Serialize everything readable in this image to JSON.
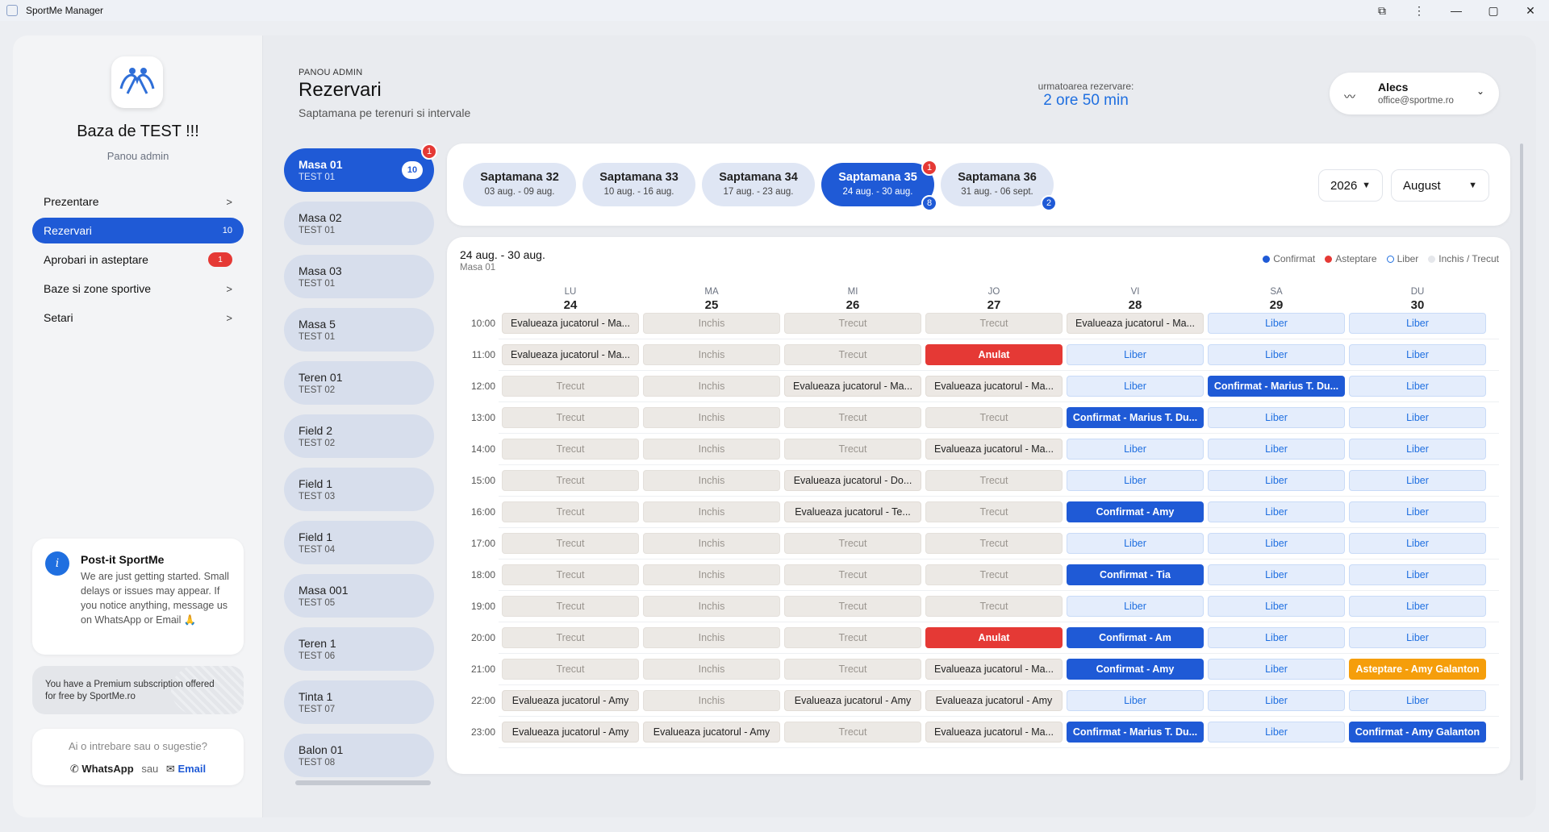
{
  "window": {
    "title": "SportMe Manager"
  },
  "sidebar": {
    "base_name": "Baza de TEST !!!",
    "base_sub": "Panou admin",
    "nav": [
      {
        "label": "Prezentare",
        "chevron": ">"
      },
      {
        "label": "Rezervari",
        "count": "10",
        "active": true
      },
      {
        "label": "Aprobari in asteptare",
        "badge": "1"
      },
      {
        "label": "Baze si zone sportive",
        "chevron": ">"
      },
      {
        "label": "Setari",
        "chevron": ">"
      }
    ],
    "postit": {
      "title": "Post-it SportMe",
      "text": "We are just getting started. Small delays or issues may appear. If you notice anything, message us on WhatsApp or Email 🙏"
    },
    "premium_text": "You have a Premium subscription offered for free by SportMe.ro",
    "question": {
      "text": "Ai o intrebare sau o sugestie?",
      "whatsapp": "WhatsApp",
      "sau": "sau",
      "email": "Email"
    }
  },
  "header": {
    "overline": "PANOU ADMIN",
    "title": "Rezervari",
    "subtitle": "Saptamana pe terenuri si intervale",
    "next_label": "urmatoarea rezervare:",
    "next_value": "2 ore 50 min"
  },
  "user": {
    "name": "Alecs",
    "email": "office@sportme.ro"
  },
  "resources": [
    {
      "name": "Masa 01",
      "sub": "TEST 01",
      "count": "10",
      "alert": "1",
      "active": true
    },
    {
      "name": "Masa 02",
      "sub": "TEST 01"
    },
    {
      "name": "Masa 03",
      "sub": "TEST 01"
    },
    {
      "name": "Masa 5",
      "sub": "TEST 01"
    },
    {
      "name": "Teren 01",
      "sub": "TEST 02"
    },
    {
      "name": "Field 2",
      "sub": "TEST 02"
    },
    {
      "name": "Field 1",
      "sub": "TEST 03"
    },
    {
      "name": "Field 1",
      "sub": "TEST 04"
    },
    {
      "name": "Masa 001",
      "sub": "TEST 05"
    },
    {
      "name": "Teren 1",
      "sub": "TEST 06"
    },
    {
      "name": "Tinta 1",
      "sub": "TEST 07"
    },
    {
      "name": "Balon 01",
      "sub": "TEST 08"
    }
  ],
  "weeks": [
    {
      "name": "Saptamana 32",
      "range": "03 aug. - 09 aug."
    },
    {
      "name": "Saptamana 33",
      "range": "10 aug. - 16 aug."
    },
    {
      "name": "Saptamana 34",
      "range": "17 aug. - 23 aug."
    },
    {
      "name": "Saptamana 35",
      "range": "24 aug. - 30 aug.",
      "active": true,
      "alert": "1",
      "count": "8"
    },
    {
      "name": "Saptamana 36",
      "range": "31 aug. - 06 sept.",
      "count": "2"
    }
  ],
  "year_select": "2026",
  "month_select": "August",
  "calendar": {
    "range": "24 aug. - 30 aug.",
    "resource": "Masa 01",
    "legend": [
      {
        "label": "Confirmat",
        "color": "#1f5ad6"
      },
      {
        "label": "Asteptare",
        "color": "#e53935"
      },
      {
        "label": "Liber",
        "color": "ring"
      },
      {
        "label": "Inchis / Trecut",
        "color": "#e5e7eb"
      }
    ],
    "days": [
      {
        "name": "LU",
        "num": "24"
      },
      {
        "name": "MA",
        "num": "25"
      },
      {
        "name": "MI",
        "num": "26"
      },
      {
        "name": "JO",
        "num": "27"
      },
      {
        "name": "VI",
        "num": "28"
      },
      {
        "name": "SA",
        "num": "29"
      },
      {
        "name": "DU",
        "num": "30"
      }
    ],
    "times": [
      "10:00",
      "11:00",
      "12:00",
      "13:00",
      "14:00",
      "15:00",
      "16:00",
      "17:00",
      "18:00",
      "19:00",
      "20:00",
      "21:00",
      "22:00",
      "23:00"
    ],
    "rows": [
      [
        [
          "booked",
          "Evalueaza jucatorul - Ma..."
        ],
        [
          "closed",
          "Inchis"
        ],
        [
          "past",
          "Trecut"
        ],
        [
          "past",
          "Trecut"
        ],
        [
          "booked",
          "Evalueaza jucatorul - Ma..."
        ],
        [
          "free",
          "Liber"
        ],
        [
          "free",
          "Liber"
        ]
      ],
      [
        [
          "booked",
          "Evalueaza jucatorul - Ma..."
        ],
        [
          "closed",
          "Inchis"
        ],
        [
          "past",
          "Trecut"
        ],
        [
          "cancelled",
          "Anulat"
        ],
        [
          "free",
          "Liber"
        ],
        [
          "free",
          "Liber"
        ],
        [
          "free",
          "Liber"
        ]
      ],
      [
        [
          "past",
          "Trecut"
        ],
        [
          "closed",
          "Inchis"
        ],
        [
          "booked",
          "Evalueaza jucatorul - Ma..."
        ],
        [
          "booked",
          "Evalueaza jucatorul - Ma..."
        ],
        [
          "free",
          "Liber"
        ],
        [
          "confirmed",
          "Confirmat - Marius T. Du..."
        ],
        [
          "free",
          "Liber"
        ]
      ],
      [
        [
          "past",
          "Trecut"
        ],
        [
          "closed",
          "Inchis"
        ],
        [
          "past",
          "Trecut"
        ],
        [
          "past",
          "Trecut"
        ],
        [
          "confirmed",
          "Confirmat - Marius T. Du..."
        ],
        [
          "free",
          "Liber"
        ],
        [
          "free",
          "Liber"
        ]
      ],
      [
        [
          "past",
          "Trecut"
        ],
        [
          "closed",
          "Inchis"
        ],
        [
          "past",
          "Trecut"
        ],
        [
          "booked",
          "Evalueaza jucatorul - Ma..."
        ],
        [
          "free",
          "Liber"
        ],
        [
          "free",
          "Liber"
        ],
        [
          "free",
          "Liber"
        ]
      ],
      [
        [
          "past",
          "Trecut"
        ],
        [
          "closed",
          "Inchis"
        ],
        [
          "booked",
          "Evalueaza jucatorul - Do..."
        ],
        [
          "past",
          "Trecut"
        ],
        [
          "free",
          "Liber"
        ],
        [
          "free",
          "Liber"
        ],
        [
          "free",
          "Liber"
        ]
      ],
      [
        [
          "past",
          "Trecut"
        ],
        [
          "closed",
          "Inchis"
        ],
        [
          "booked",
          "Evalueaza jucatorul - Te..."
        ],
        [
          "past",
          "Trecut"
        ],
        [
          "confirmed",
          "Confirmat - Amy"
        ],
        [
          "free",
          "Liber"
        ],
        [
          "free",
          "Liber"
        ]
      ],
      [
        [
          "past",
          "Trecut"
        ],
        [
          "closed",
          "Inchis"
        ],
        [
          "past",
          "Trecut"
        ],
        [
          "past",
          "Trecut"
        ],
        [
          "free",
          "Liber"
        ],
        [
          "free",
          "Liber"
        ],
        [
          "free",
          "Liber"
        ]
      ],
      [
        [
          "past",
          "Trecut"
        ],
        [
          "closed",
          "Inchis"
        ],
        [
          "past",
          "Trecut"
        ],
        [
          "past",
          "Trecut"
        ],
        [
          "confirmed",
          "Confirmat - Tia"
        ],
        [
          "free",
          "Liber"
        ],
        [
          "free",
          "Liber"
        ]
      ],
      [
        [
          "past",
          "Trecut"
        ],
        [
          "closed",
          "Inchis"
        ],
        [
          "past",
          "Trecut"
        ],
        [
          "past",
          "Trecut"
        ],
        [
          "free",
          "Liber"
        ],
        [
          "free",
          "Liber"
        ],
        [
          "free",
          "Liber"
        ]
      ],
      [
        [
          "past",
          "Trecut"
        ],
        [
          "closed",
          "Inchis"
        ],
        [
          "past",
          "Trecut"
        ],
        [
          "cancelled",
          "Anulat"
        ],
        [
          "confirmed",
          "Confirmat - Am"
        ],
        [
          "free",
          "Liber"
        ],
        [
          "free",
          "Liber"
        ]
      ],
      [
        [
          "past",
          "Trecut"
        ],
        [
          "closed",
          "Inchis"
        ],
        [
          "past",
          "Trecut"
        ],
        [
          "booked",
          "Evalueaza jucatorul - Ma..."
        ],
        [
          "confirmed",
          "Confirmat - Amy"
        ],
        [
          "free",
          "Liber"
        ],
        [
          "pending",
          "Asteptare - Amy Galanton"
        ]
      ],
      [
        [
          "booked",
          "Evalueaza jucatorul - Amy"
        ],
        [
          "closed",
          "Inchis"
        ],
        [
          "booked",
          "Evalueaza jucatorul - Amy"
        ],
        [
          "booked",
          "Evalueaza jucatorul - Amy"
        ],
        [
          "free",
          "Liber"
        ],
        [
          "free",
          "Liber"
        ],
        [
          "free",
          "Liber"
        ]
      ],
      [
        [
          "booked",
          "Evalueaza jucatorul - Amy"
        ],
        [
          "booked",
          "Evalueaza jucatorul - Amy"
        ],
        [
          "past",
          "Trecut"
        ],
        [
          "booked",
          "Evalueaza jucatorul - Ma..."
        ],
        [
          "confirmed",
          "Confirmat - Marius T. Du..."
        ],
        [
          "free",
          "Liber"
        ],
        [
          "confirmed",
          "Confirmat - Amy Galanton"
        ]
      ]
    ]
  }
}
